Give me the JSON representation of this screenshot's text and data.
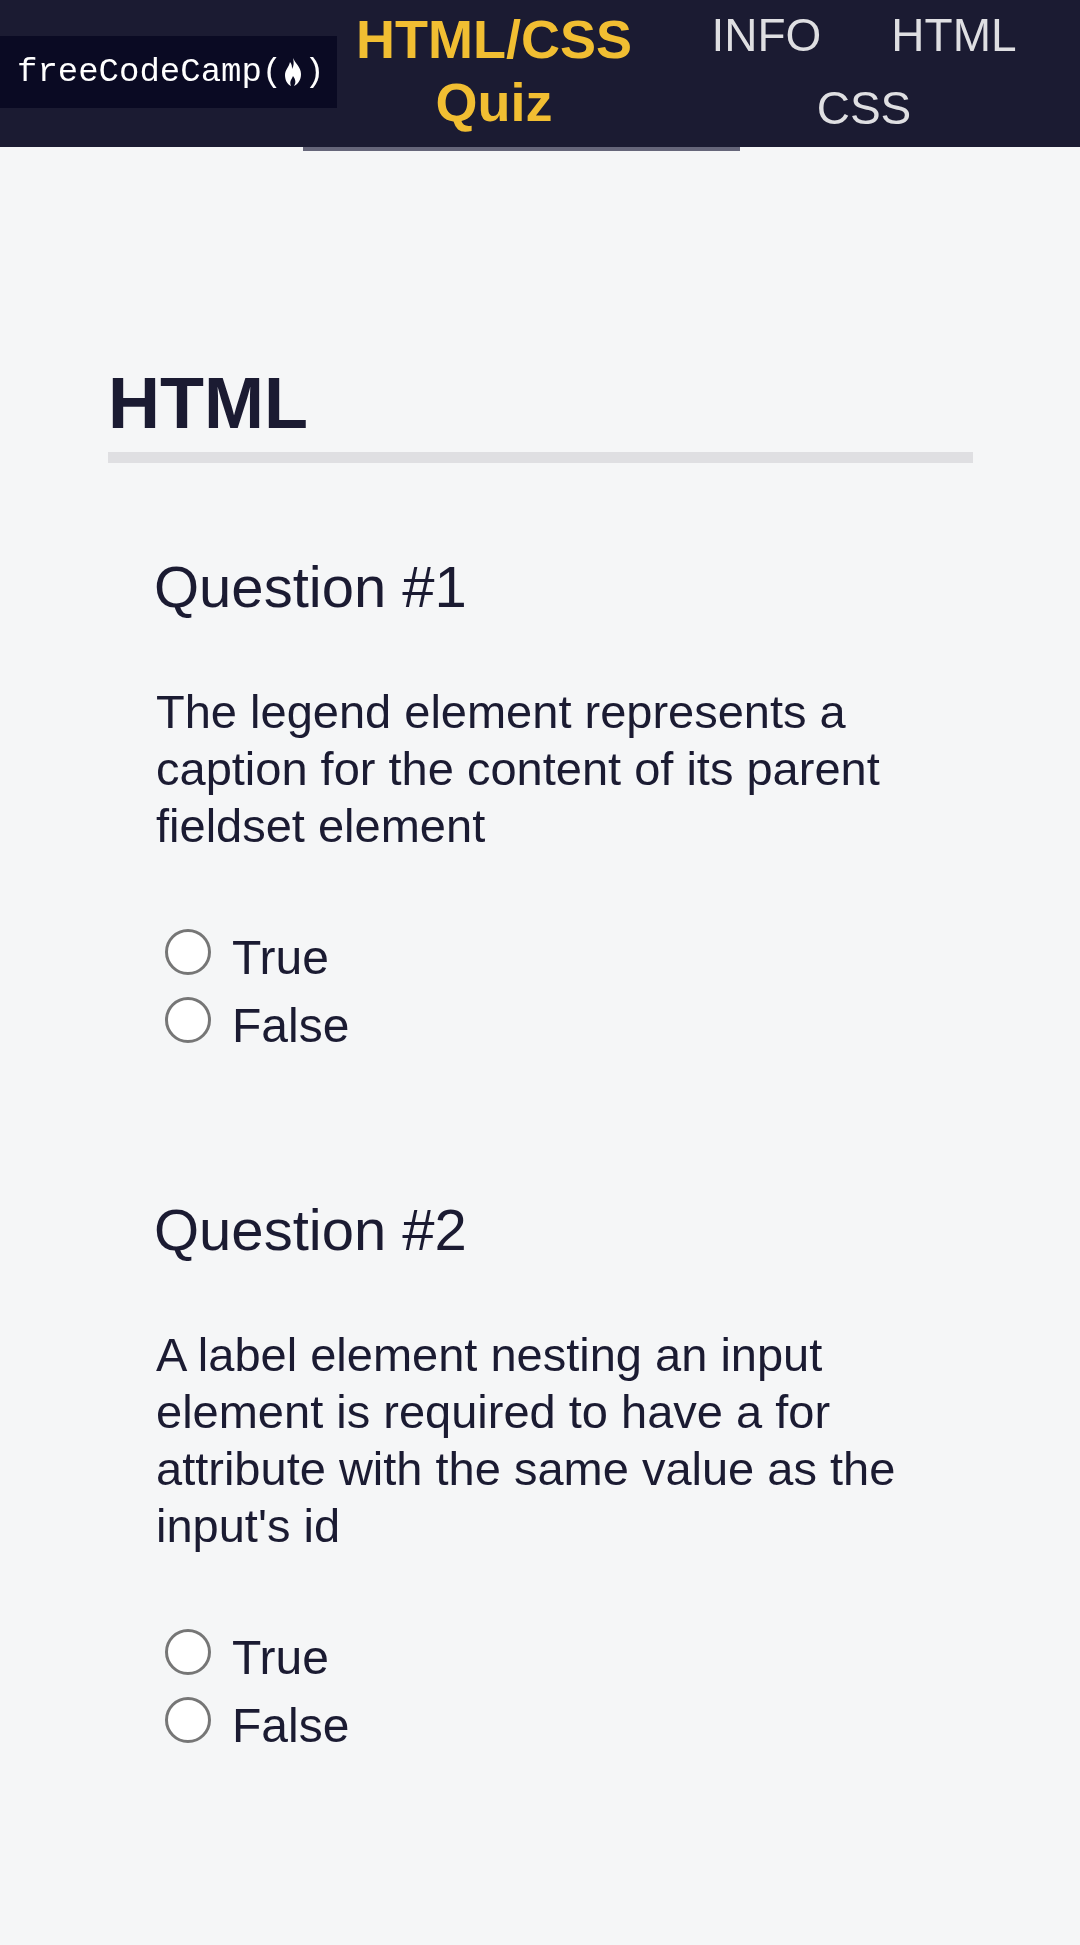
{
  "header": {
    "logo": {
      "text": "freeCodeCamp(",
      "closing": ")"
    },
    "title": "HTML/CSS Quiz",
    "nav": [
      {
        "label": "INFO"
      },
      {
        "label": "HTML"
      },
      {
        "label": "CSS"
      }
    ]
  },
  "section": {
    "heading": "HTML",
    "questions": [
      {
        "title": "Question #1",
        "text": "The legend element represents a caption for the content of its parent fieldset element",
        "options": [
          {
            "label": "True",
            "selected": false
          },
          {
            "label": "False",
            "selected": false
          }
        ]
      },
      {
        "title": "Question #2",
        "text": "A label element nesting an input element is required to have a for attribute with the same value as the input's id",
        "options": [
          {
            "label": "True",
            "selected": false
          },
          {
            "label": "False",
            "selected": false
          }
        ]
      }
    ]
  }
}
